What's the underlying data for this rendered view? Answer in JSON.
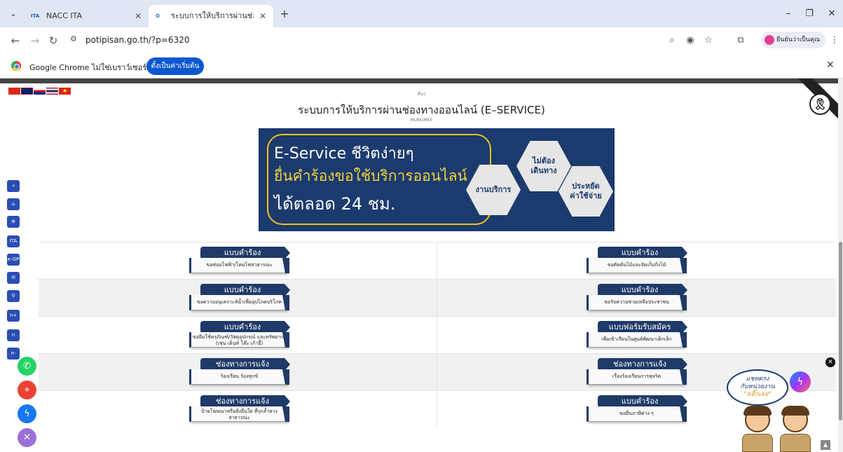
{
  "browser": {
    "tabs": [
      {
        "favicon": "ITA",
        "title": "NACC ITA"
      },
      {
        "favicon": "seal-icon",
        "title": "ระบบการให้บริการผ่านช่องทางออนไล"
      }
    ],
    "url": "potipisan.go.th/?p=6320",
    "profile_label": "ยืนยันว่าเป็นคุณ"
  },
  "infobar": {
    "message": "Google Chrome ไม่ใช่เบราว์เซอร์เริ่มต้น",
    "button_label": "ตั้งเป็นค่าเริ่มต้น"
  },
  "page": {
    "small_top": "อื่นๆ",
    "heading": "ระบบการให้บริการผ่านช่องทางออนไลน์ (E–SERVICE)",
    "small_sub": "MUNGMEE",
    "ribbon_symbol": "🎗"
  },
  "banner": {
    "line1": "E-Service  ชีวิตง่ายๆ",
    "line2": "ยื่นคำร้องขอใช้บริการออนไลน์",
    "line3": "ได้ตลอด 24 ชม.",
    "hex1": "งานบริการ",
    "hex2": "ไม่ต้อง\nเดินทาง",
    "hex3": "ประหยัด\nค่าใช้จ่าย"
  },
  "forms": [
    {
      "left": {
        "head": "แบบคำร้อง",
        "sub": "ขอซ่อมไฟฟ้า/โคมไฟสาธารณะ"
      },
      "right": {
        "head": "แบบคำร้อง",
        "sub": "ขอตัดต้นไม้และจัดเก็บกิ่งไม้"
      }
    },
    {
      "left": {
        "head": "แบบคำร้อง",
        "sub": "ขอความอนุเคราะห์น้ำเพื่ออุปโภคบริโภค"
      },
      "right": {
        "head": "แบบคำร้อง",
        "sub": "ขอรับความช่วยเหลือประชาชน"
      }
    },
    {
      "left": {
        "head": "แบบคำร้อง",
        "sub": "ขอยืมใช้ครุภัณฑ์/วัสดุอุปกรณ์ และทรัพยากร (เช่น เต็นท์ โต๊ะ เก้าอี้)"
      },
      "right": {
        "head": "แบบฟอร์มรับสมัคร",
        "sub": "เพื่อเข้าเรียนในศูนย์พัฒนาเด็กเล็ก"
      }
    },
    {
      "left": {
        "head": "ช่องทางการแจ้ง",
        "sub": "ร้องเรียน ร้องทุกข์"
      },
      "right": {
        "head": "ช่องทางการแจ้ง",
        "sub": "เรื่องร้องเรียนการทุจริต"
      }
    },
    {
      "left": {
        "head": "ช่องทางการแจ้ง",
        "sub": "ป้ายโฆษณาหรือสิ่งอื่นใด ที่รุกล้ำทางสาธารณะ"
      },
      "right": {
        "head": "แบบคำร้อง",
        "sub": "ขอยื่นภาษีต่าง ๆ"
      }
    }
  ],
  "sidebar": {
    "items": [
      "«",
      "home-icon",
      "globe-icon",
      "ITA",
      "e-GP",
      "mail-icon",
      "person-icon",
      "n+",
      "n",
      "n-"
    ]
  },
  "chat": {
    "bubble_line1": "แชทตรง",
    "bubble_line2": "กับหน่วยงาน",
    "bubble_line3": "\"คลิ๊กเลย\""
  },
  "colors": {
    "navy": "#1f3a68",
    "accent_blue": "#0b57d0",
    "gold": "#f0c419",
    "phone_green": "#25d366",
    "map_red": "#ea4335",
    "messenger_blue": "#1877f2",
    "close_purple": "#9c6fd6"
  }
}
